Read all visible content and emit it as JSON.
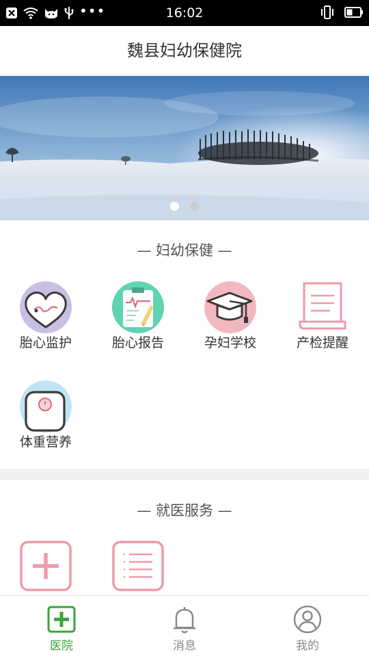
{
  "status_bar": {
    "time": "16:02",
    "left_dots": "•••"
  },
  "header": {
    "title": "魏县妇幼保健院"
  },
  "banner": {
    "slide_count": 2,
    "active_slide": 1
  },
  "maternal_section": {
    "title": "— 妇幼保健 —",
    "items": [
      {
        "label": "胎心监护",
        "icon": "fetal-heart-monitor-icon"
      },
      {
        "label": "胎心报告",
        "icon": "fetal-heart-report-icon"
      },
      {
        "label": "孕妇学校",
        "icon": "pregnancy-school-icon"
      },
      {
        "label": "产检提醒",
        "icon": "prenatal-reminder-icon"
      },
      {
        "label": "体重营养",
        "icon": "weight-scale-icon"
      }
    ]
  },
  "medical_section": {
    "title": "— 就医服务 —",
    "items": [
      {
        "icon": "plus-icon"
      },
      {
        "icon": "list-icon"
      }
    ]
  },
  "tab_bar": {
    "tabs": [
      {
        "label": "医院",
        "icon": "hospital-icon",
        "active": true
      },
      {
        "label": "消息",
        "icon": "bell-icon",
        "active": false
      },
      {
        "label": "我的",
        "icon": "user-icon",
        "active": false
      }
    ]
  },
  "colors": {
    "accent_green": "#3aa33a",
    "icon_pink": "#ee9aa8",
    "icon_lavender": "#c9bfe3",
    "icon_mint": "#5fd3b2",
    "icon_sky": "#bfe4f3"
  }
}
